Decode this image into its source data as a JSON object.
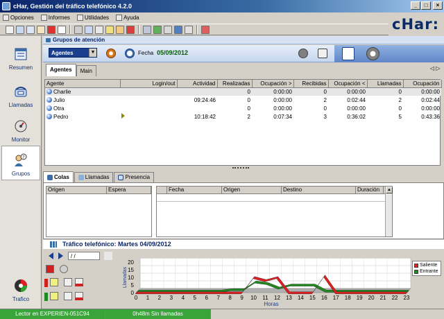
{
  "window": {
    "title": "cHar, Gestión del tráfico telefónico 4.2.0",
    "min_label": "_",
    "max_label": "□",
    "close_label": "×"
  },
  "menu": {
    "items": [
      "Opciones",
      "Informes",
      "Utilidades",
      "Ayuda"
    ]
  },
  "brand": {
    "logo_text": "cHar:"
  },
  "sidebar": {
    "items": [
      {
        "label": "Resumen",
        "icon": "calendar-icon"
      },
      {
        "label": "Llamadas",
        "icon": "phone-icon"
      },
      {
        "label": "Monitor",
        "icon": "monitor-icon"
      },
      {
        "label": "Grupos",
        "icon": "group-icon",
        "active": true
      },
      {
        "label": "Trafico",
        "icon": "traffic-icon"
      }
    ]
  },
  "panel": {
    "title": "Grupos de atención",
    "selector_value": "Agentes",
    "fecha_label": "Fecha",
    "fecha_value": "05/09/2012"
  },
  "tabs": [
    "Agentes",
    "Main"
  ],
  "tab_arrows": "◁ ▷",
  "agent_table": {
    "columns": [
      "Agente",
      "Login/out",
      "Actividad",
      "Realizadas",
      "Ocupación >",
      "Recibidas",
      "Ocupación <",
      "Llamadas",
      "Ocupación"
    ],
    "rows": [
      {
        "agente": "Charlie",
        "login": "",
        "actividad": "",
        "realizadas": "0",
        "ocup_out": "0:00:00",
        "recibidas": "0",
        "ocup_in": "0:00:00",
        "llamadas": "0",
        "ocupacion": "0:00:00",
        "selected": true
      },
      {
        "agente": "Julio",
        "login": "",
        "actividad": "09:24:46",
        "realizadas": "0",
        "ocup_out": "0:00:00",
        "recibidas": "2",
        "ocup_in": "0:02:44",
        "llamadas": "2",
        "ocupacion": "0:02:44"
      },
      {
        "agente": "Otra",
        "login": "",
        "actividad": "",
        "realizadas": "0",
        "ocup_out": "0:00:00",
        "recibidas": "0",
        "ocup_in": "0:00:00",
        "llamadas": "0",
        "ocupacion": "0:00:00"
      },
      {
        "agente": "Pedro",
        "login": "arrow",
        "actividad": "10:18:42",
        "realizadas": "2",
        "ocup_out": "0:07:34",
        "recibidas": "3",
        "ocup_in": "0:36:02",
        "llamadas": "5",
        "ocupacion": "0:43:36"
      }
    ]
  },
  "lower_tabs": [
    "Colas",
    "Llamadas",
    "Presencia"
  ],
  "colas_grid": {
    "columns": [
      "Origen",
      "Espera"
    ]
  },
  "calls_grid": {
    "columns": [
      "Fecha",
      "Origen",
      "Destino",
      "Duración"
    ]
  },
  "traffic": {
    "title": "Tráfico telefónico: Martes 04/09/2012",
    "date_input": "/ /"
  },
  "chart_data": {
    "type": "area",
    "xlabel": "Horas",
    "ylabel": "Llamadas",
    "x": [
      0,
      1,
      2,
      3,
      4,
      5,
      6,
      7,
      8,
      9,
      10,
      11,
      12,
      13,
      14,
      15,
      16,
      17,
      18,
      19,
      20,
      21,
      22,
      23
    ],
    "ylim": [
      0,
      20
    ],
    "yticks": [
      0,
      5,
      10,
      15,
      20
    ],
    "series": [
      {
        "name": "Saliente",
        "color": "#e02020",
        "values": [
          0,
          0,
          0,
          0,
          0,
          0,
          0,
          0,
          0,
          0,
          10,
          8,
          10,
          0,
          0,
          0,
          11,
          0,
          0,
          0,
          0,
          0,
          0,
          0
        ]
      },
      {
        "name": "Entrante",
        "color": "#208a20",
        "values": [
          0,
          0,
          0,
          0,
          0,
          0,
          0,
          0,
          1,
          1,
          6,
          5,
          2,
          4,
          4,
          4,
          0,
          0,
          0,
          0,
          0,
          0,
          0,
          0
        ]
      }
    ],
    "legend_position": "right"
  },
  "status": {
    "left": "Lector en EXPERIEN-051C94",
    "middle": "0h48m Sin llamadas"
  }
}
